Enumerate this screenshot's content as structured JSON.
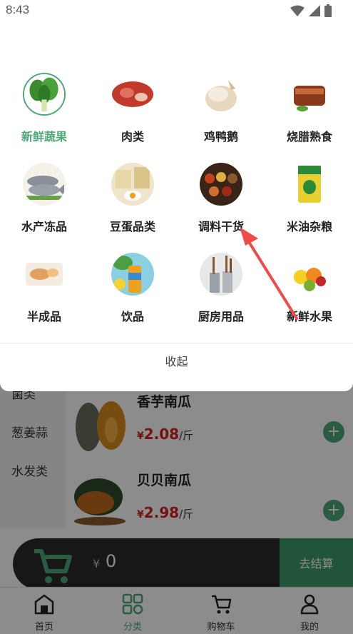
{
  "status_bar": {
    "time": "8:43"
  },
  "left_menu": {
    "items": [
      "菌类",
      "葱姜蒜",
      "水发类"
    ]
  },
  "products": [
    {
      "name": "香芋南瓜",
      "currency": "¥",
      "price": "2.08",
      "unit": "/斤"
    },
    {
      "name": "贝贝南瓜",
      "currency": "¥",
      "price": "2.98",
      "unit": "/斤"
    }
  ],
  "cart": {
    "currency": "¥",
    "amount": "0",
    "checkout_label": "去结算"
  },
  "categories": [
    {
      "label": "新鲜蔬果",
      "icon": "leafy-greens-icon",
      "active": true
    },
    {
      "label": "肉类",
      "icon": "meat-icon"
    },
    {
      "label": "鸡鸭鹅",
      "icon": "poultry-icon"
    },
    {
      "label": "烧腊熟食",
      "icon": "roast-meat-icon"
    },
    {
      "label": "水产冻品",
      "icon": "fish-icon"
    },
    {
      "label": "豆蛋品类",
      "icon": "egg-icon"
    },
    {
      "label": "调料干货",
      "icon": "spices-icon"
    },
    {
      "label": "米油杂粮",
      "icon": "rice-bag-icon"
    },
    {
      "label": "半成品",
      "icon": "prepared-food-icon"
    },
    {
      "label": "饮品",
      "icon": "drink-icon"
    },
    {
      "label": "厨房用品",
      "icon": "kitchen-utensils-icon"
    },
    {
      "label": "新鲜水果",
      "icon": "fruit-icon"
    }
  ],
  "panel": {
    "collapse_label": "收起"
  },
  "tabs": [
    {
      "label": "首页",
      "icon": "home-icon"
    },
    {
      "label": "分类",
      "icon": "category-icon",
      "active": true
    },
    {
      "label": "购物车",
      "icon": "cart-icon"
    },
    {
      "label": "我的",
      "icon": "profile-icon"
    }
  ],
  "colors": {
    "accent": "#4ea87a",
    "price": "#d42020",
    "cart_bar": "#2b2b2b",
    "annotation_arrow": "#f04a4a"
  }
}
